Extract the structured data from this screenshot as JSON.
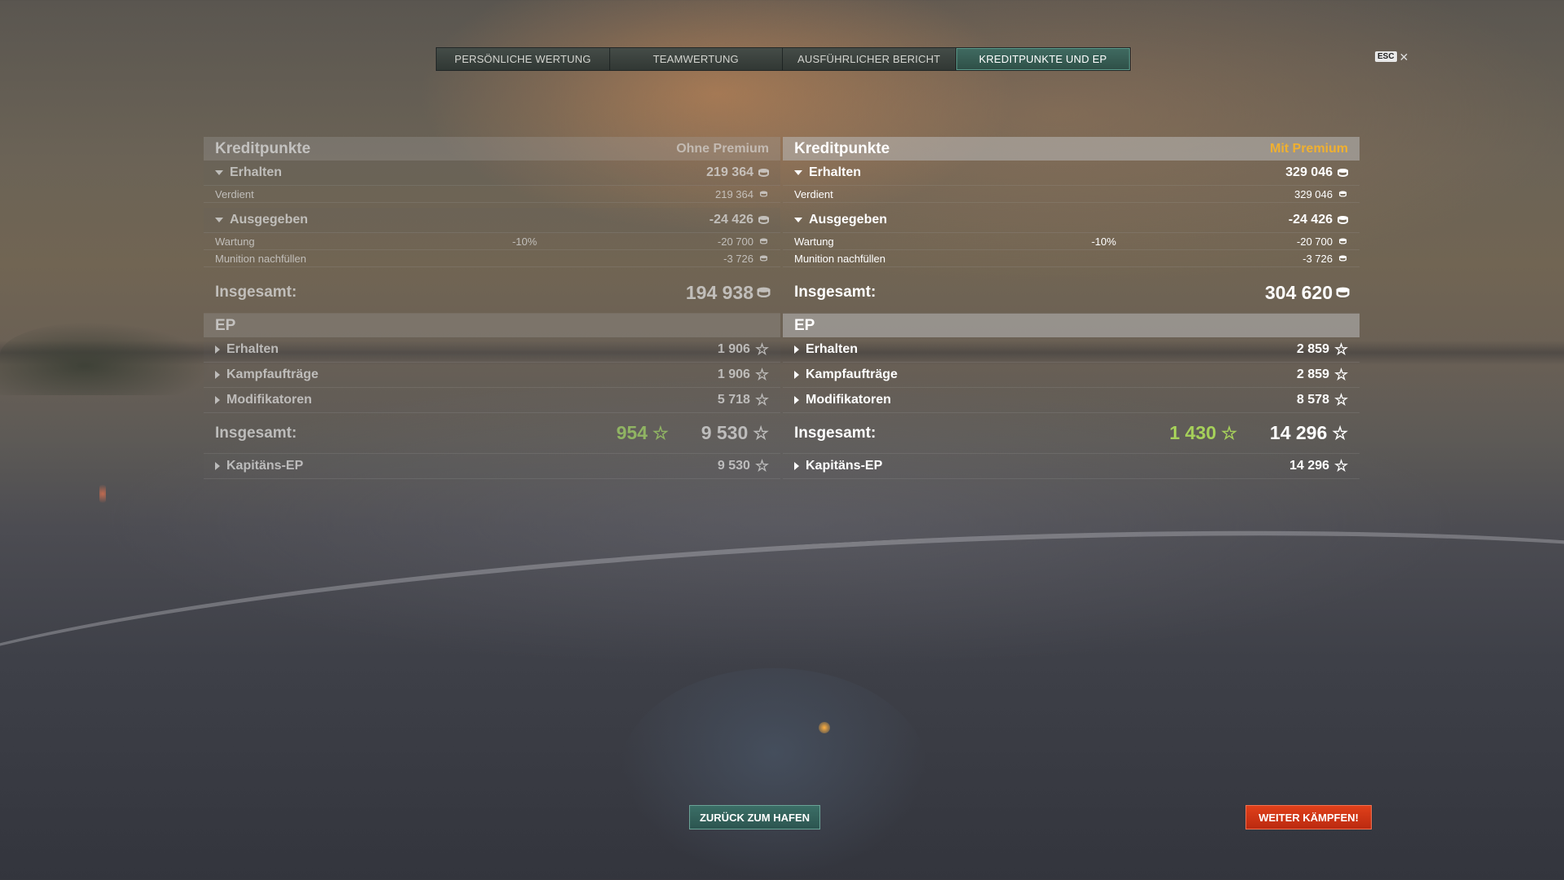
{
  "tabs": [
    "PERSÖNLICHE WERTUNG",
    "TEAMWERTUNG",
    "AUSFÜHRLICHER BERICHT",
    "KREDITPUNKTE UND EP"
  ],
  "active_tab": "KREDITPUNKTE UND EP",
  "esc_label": "ESC",
  "left": {
    "credits_title": "Kreditpunkte",
    "credits_subtitle": "Ohne Premium",
    "earned_label": "Erhalten",
    "earned_value": "219 364",
    "verdient_label": "Verdient",
    "verdient_value": "219 364",
    "spent_label": "Ausgegeben",
    "spent_value": "-24 426",
    "wartung_label": "Wartung",
    "wartung_pct": "-10%",
    "wartung_value": "-20 700",
    "munition_label": "Munition nachfüllen",
    "munition_value": "-3 726",
    "credits_total_label": "Insgesamt:",
    "credits_total_value": "194 938",
    "xp_title": "EP",
    "xp_earned_label": "Erhalten",
    "xp_earned_value": "1 906",
    "missions_label": "Kampfaufträge",
    "missions_value": "1 906",
    "modifiers_label": "Modifikatoren",
    "modifiers_value": "5 718",
    "xp_total_label": "Insgesamt:",
    "xp_total_base": "954",
    "xp_total_value": "9 530",
    "captain_label": "Kapitäns-EP",
    "captain_value": "9 530"
  },
  "right": {
    "credits_title": "Kreditpunkte",
    "credits_subtitle": "Mit Premium",
    "earned_label": "Erhalten",
    "earned_value": "329 046",
    "verdient_label": "Verdient",
    "verdient_value": "329 046",
    "spent_label": "Ausgegeben",
    "spent_value": "-24 426",
    "wartung_label": "Wartung",
    "wartung_pct": "-10%",
    "wartung_value": "-20 700",
    "munition_label": "Munition nachfüllen",
    "munition_value": "-3 726",
    "credits_total_label": "Insgesamt:",
    "credits_total_value": "304 620",
    "xp_title": "EP",
    "xp_earned_label": "Erhalten",
    "xp_earned_value": "2 859",
    "missions_label": "Kampfaufträge",
    "missions_value": "2 859",
    "modifiers_label": "Modifikatoren",
    "modifiers_value": "8 578",
    "xp_total_label": "Insgesamt:",
    "xp_total_base": "1 430",
    "xp_total_value": "14 296",
    "captain_label": "Kapitäns-EP",
    "captain_value": "14 296"
  },
  "buttons": {
    "back": "ZURÜCK ZUM HAFEN",
    "fight": "WEITER KÄMPFEN!"
  },
  "colors": {
    "premium_accent": "#f0b030",
    "xp_base_green": "#a6d05a",
    "active_tab": "#3f6a60",
    "fight_button": "#e0401a"
  },
  "icons": [
    "credits-icon",
    "xp-star-icon",
    "caret-down-icon",
    "caret-right-icon",
    "close-icon"
  ]
}
